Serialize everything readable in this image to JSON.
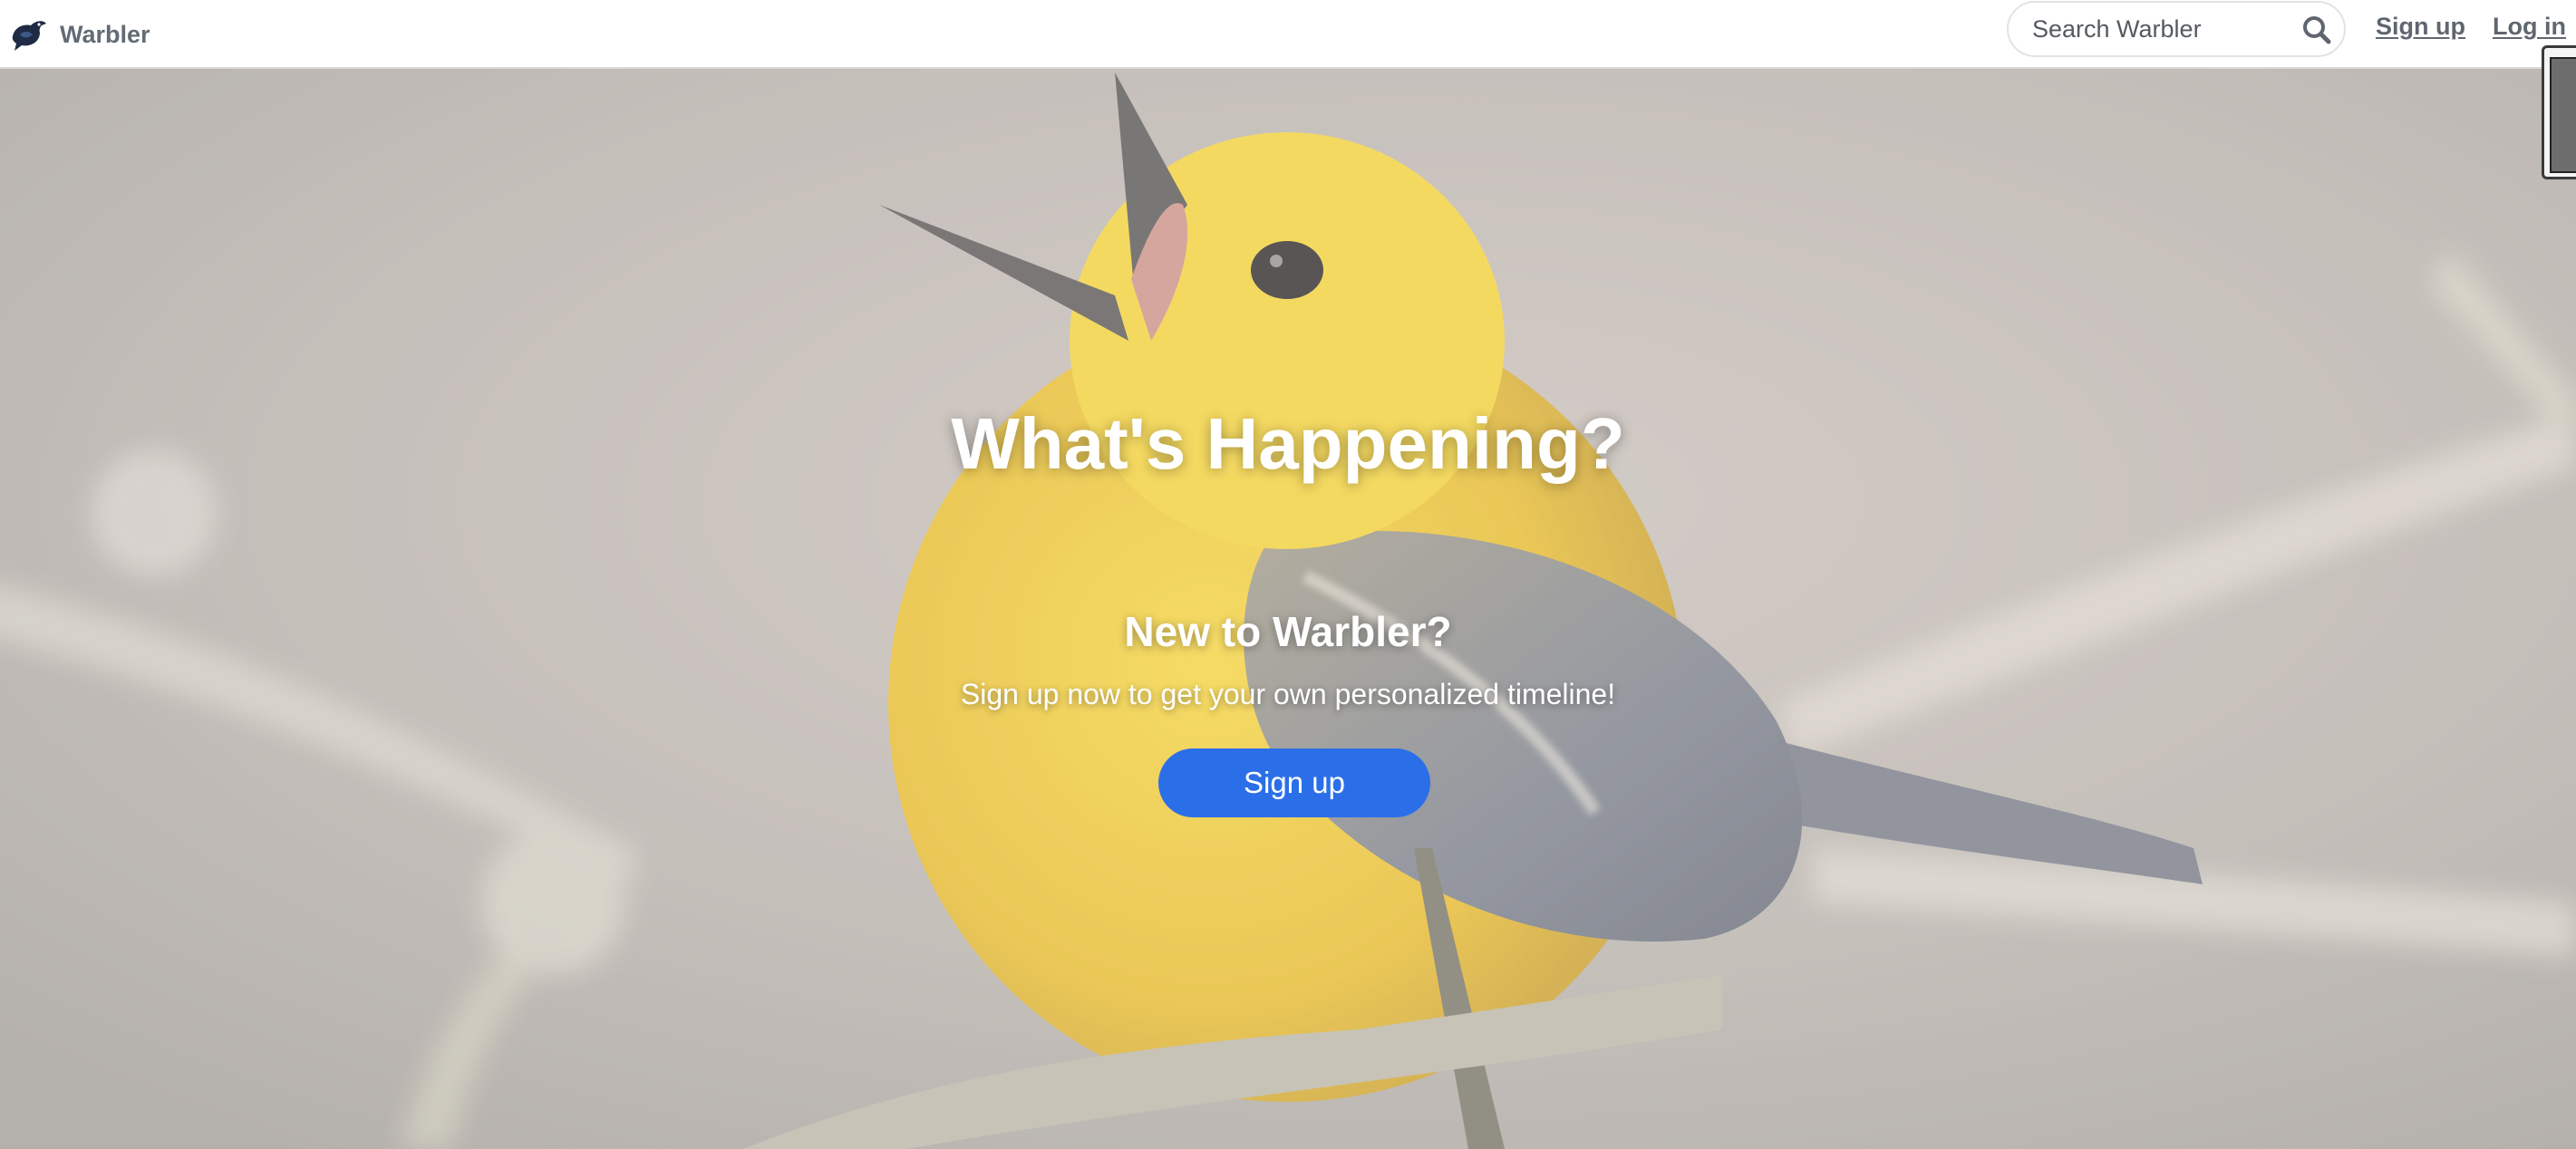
{
  "navbar": {
    "brand_name": "Warbler",
    "brand_icon": "warbler-bird-logo-icon",
    "search": {
      "placeholder": "Search Warbler",
      "value": "",
      "icon": "search-icon"
    },
    "links": {
      "signup": "Sign up",
      "login": "Log in"
    }
  },
  "hero": {
    "title": "What's Happening?",
    "subtitle": "New to Warbler?",
    "text": "Sign up now to get your own personalized timeline!",
    "button_label": "Sign up",
    "background": "yellow-warbler-bird-photo"
  },
  "colors": {
    "accent": "#2b6fe8",
    "nav_text": "#5f6670",
    "navbar_bg": "#ffffff",
    "hero_text": "#ffffff"
  }
}
